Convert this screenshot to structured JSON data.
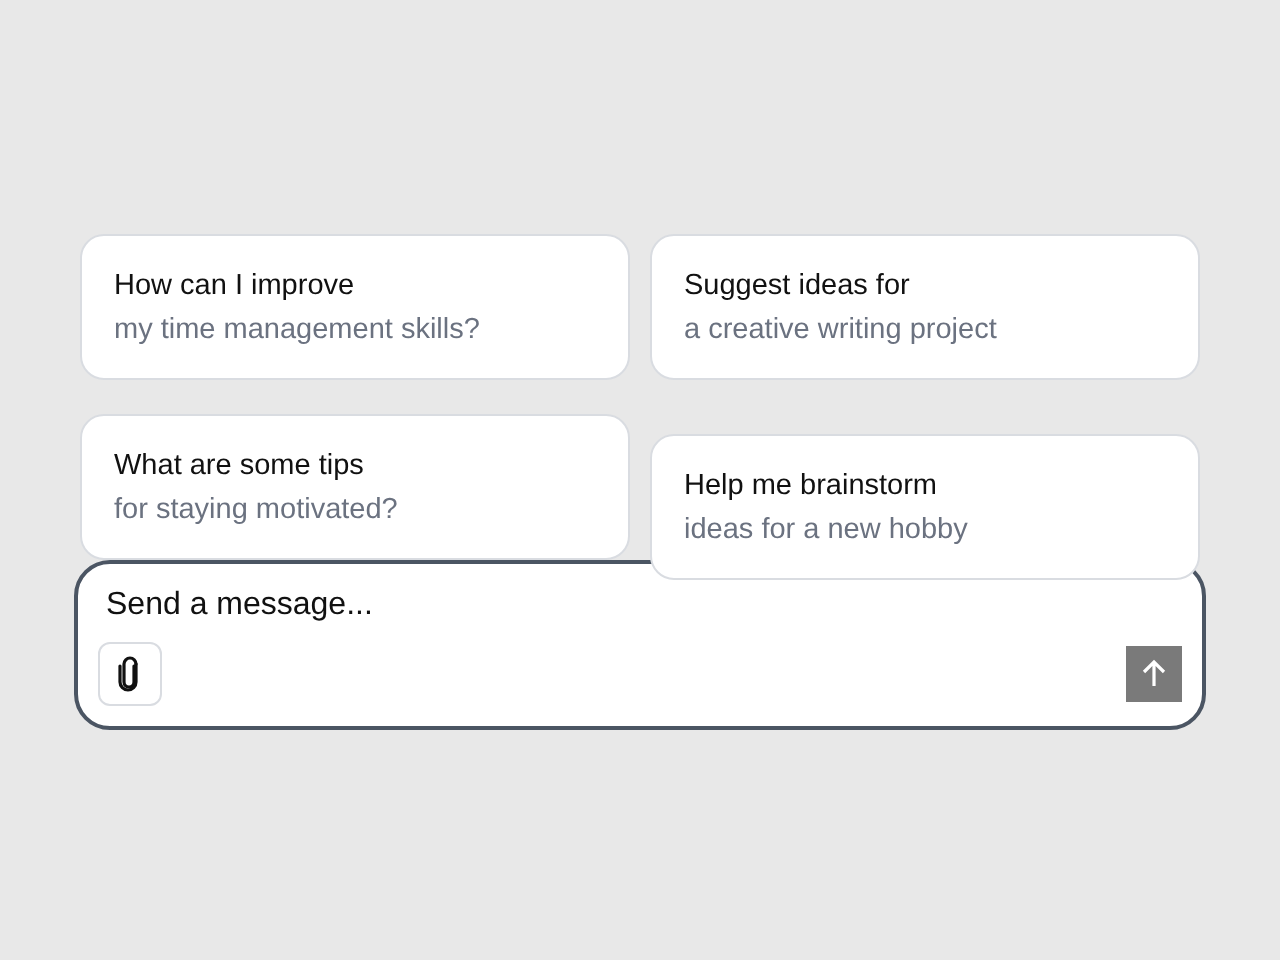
{
  "suggestions": [
    {
      "title": "How can I improve",
      "subtitle": "my time management skills?"
    },
    {
      "title": "Suggest ideas for",
      "subtitle": "a creative writing project"
    },
    {
      "title": "What are some tips",
      "subtitle": "for staying motivated?"
    },
    {
      "title": "Help me brainstorm",
      "subtitle": "ideas for a new hobby"
    }
  ],
  "composer": {
    "placeholder": "Send a message..."
  }
}
